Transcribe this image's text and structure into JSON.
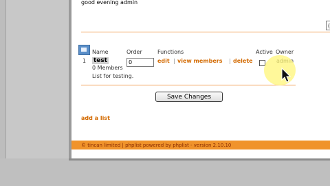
{
  "greeting": "good evening admin",
  "right_box_text": "(",
  "table": {
    "headers": {
      "name": "Name",
      "order": "Order",
      "functions": "Functions",
      "active": "Active",
      "owner": "Owner"
    },
    "rows": [
      {
        "index": "1",
        "name": "test",
        "members": "0 Members",
        "order": "0",
        "edit": "edit",
        "view_members": "view members",
        "delete": "delete",
        "owner": "admin",
        "description": "List for testing."
      }
    ]
  },
  "separators": {
    "sep1": "|",
    "sep2": "|"
  },
  "save_button": "Save Changes",
  "add_list": "add a list",
  "footer": "© tincan limited  |  phplist powered by phplist - version 2.10.10"
}
